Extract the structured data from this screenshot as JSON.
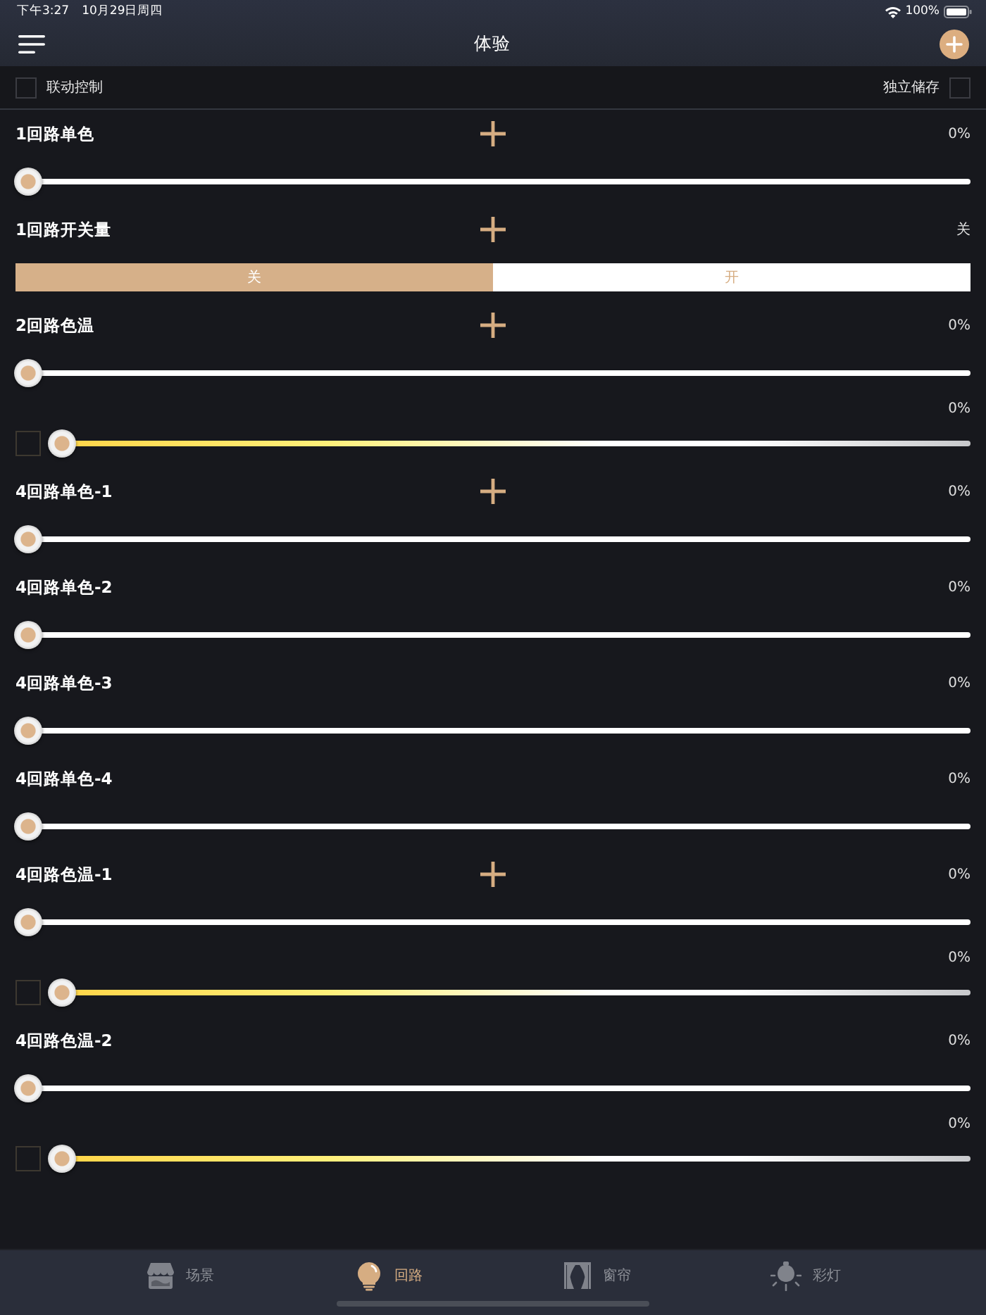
{
  "status_bar": {
    "time": "下午3:27",
    "date": "10月29日周四",
    "battery": "100%"
  },
  "nav_bar": {
    "title": "体验"
  },
  "options": [
    {
      "label": "联动控制",
      "checked": false
    },
    {
      "label": "独立储存",
      "checked": false
    }
  ],
  "circuits": [
    {
      "kind": "dimmer",
      "name": "1回路单色",
      "add_button": true,
      "reading": "0%",
      "level": 0
    },
    {
      "kind": "switch",
      "name": "1回路开关量",
      "add_button": true,
      "reading": "关",
      "segments": [
        {
          "label": "关",
          "selected": true
        },
        {
          "label": "开",
          "selected": false
        }
      ]
    },
    {
      "kind": "color_temp",
      "name": "2回路色温",
      "add_button": true,
      "reading": "0%",
      "level": 0,
      "temp_slider": {
        "reading": "0%",
        "checked": false,
        "level": 0
      }
    },
    {
      "kind": "dimmer",
      "name": "4回路单色-1",
      "add_button": true,
      "reading": "0%",
      "level": 0
    },
    {
      "kind": "dimmer",
      "name": "4回路单色-2",
      "add_button": false,
      "reading": "0%",
      "level": 0
    },
    {
      "kind": "dimmer",
      "name": "4回路单色-3",
      "add_button": false,
      "reading": "0%",
      "level": 0
    },
    {
      "kind": "dimmer",
      "name": "4回路单色-4",
      "add_button": false,
      "reading": "0%",
      "level": 0
    },
    {
      "kind": "color_temp",
      "name": "4回路色温-1",
      "add_button": true,
      "reading": "0%",
      "level": 0,
      "temp_slider": {
        "reading": "0%",
        "checked": false,
        "level": 0
      }
    },
    {
      "kind": "color_temp",
      "name": "4回路色温-2",
      "add_button": false,
      "reading": "0%",
      "level": 0,
      "temp_slider": {
        "reading": "0%",
        "checked": false,
        "level": 0
      }
    }
  ],
  "tab_bar": [
    {
      "label": "场景",
      "selected": false
    },
    {
      "label": "回路",
      "selected": true
    },
    {
      "label": "窗帘",
      "selected": false
    },
    {
      "label": "彩灯",
      "selected": false
    }
  ]
}
